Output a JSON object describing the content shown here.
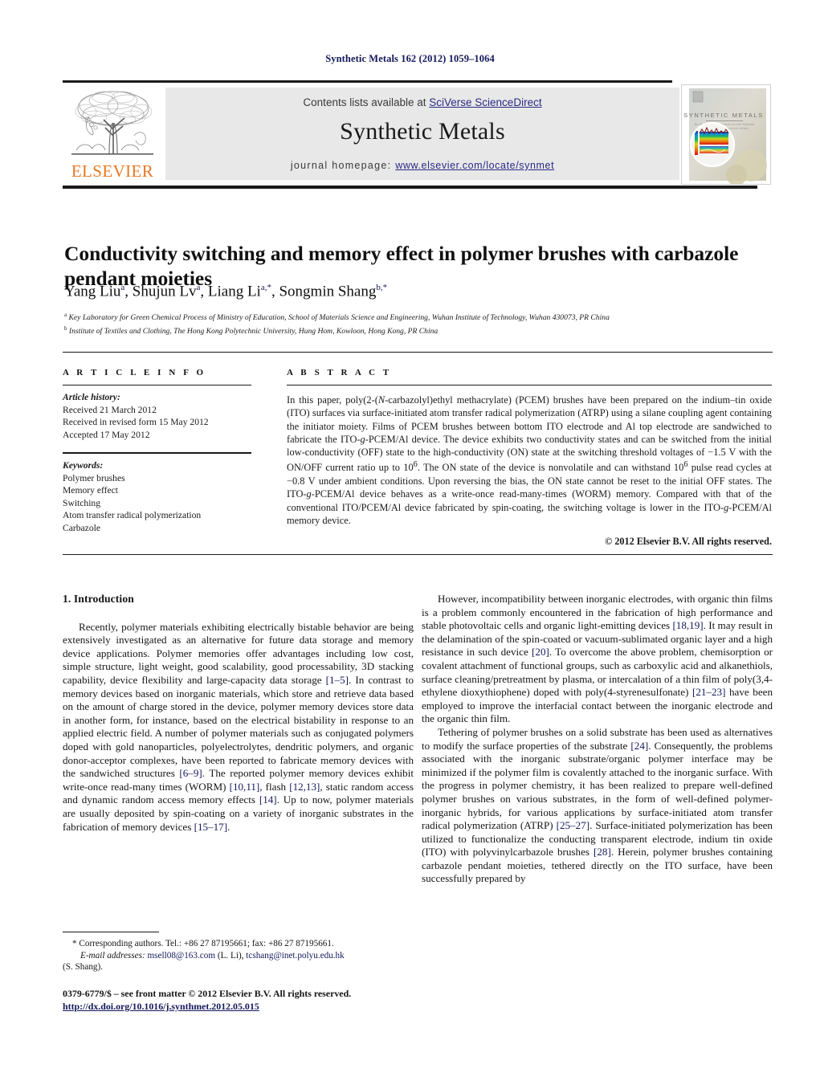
{
  "running_head": "Synthetic Metals 162 (2012) 1059–1064",
  "masthead": {
    "contents_prefix": "Contents lists available at ",
    "contents_link": "SciVerse ScienceDirect",
    "journal_title": "Synthetic Metals",
    "homepage_prefix": "journal homepage:",
    "homepage_url": "www.elsevier.com/locate/synmet",
    "publisher": "ELSEVIER",
    "cover_title": "SYNTHETIC METALS",
    "accent_orange": "#e87722",
    "link_color": "#2a2a86",
    "panel_color": "#e8e8e8"
  },
  "article": {
    "title": "Conductivity switching and memory effect in polymer brushes with carbazole pendant moieties",
    "authors_html": "Yang Liu<sup>a</sup>, Shujun Lv<sup>a</sup>, Liang Li<sup>a,*</sup>, Songmin Shang<sup>b,*</sup>",
    "affiliation_a": "Key Laboratory for Green Chemical Process of Ministry of Education, School of Materials Science and Engineering, Wuhan Institute of Technology, Wuhan 430073, PR China",
    "affiliation_b": "Institute of Textiles and Clothing, The Hong Kong Polytechnic University, Hung Hom, Kowloon, Hong Kong, PR China"
  },
  "article_info": {
    "heading": "A R T I C L E    I N F O",
    "history_label": "Article history:",
    "received": "Received 21 March 2012",
    "revised": "Received in revised form 15 May 2012",
    "accepted": "Accepted 17 May 2012",
    "keywords_label": "Keywords:",
    "keywords": [
      "Polymer brushes",
      "Memory effect",
      "Switching",
      "Atom transfer radical polymerization",
      "Carbazole"
    ]
  },
  "abstract": {
    "heading": "A B S T R A C T",
    "body_html": "In this paper, poly(2-(<i>N</i>-carbazolyl)ethyl methacrylate) (PCEM) brushes have been prepared on the indium–tin oxide (ITO) surfaces via surface-initiated atom transfer radical polymerization (ATRP) using a silane coupling agent containing the initiator moiety. Films of PCEM brushes between bottom ITO electrode and Al top electrode are sandwiched to fabricate the ITO-<i>g</i>-PCEM/Al device. The device exhibits two conductivity states and can be switched from the initial low-conductivity (OFF) state to the high-conductivity (ON) state at the switching threshold voltages of −1.5 V with the ON/OFF current ratio up to 10<sup>6</sup>. The ON state of the device is nonvolatile and can withstand 10<sup>6</sup> pulse read cycles at −0.8 V under ambient conditions. Upon reversing the bias, the ON state cannot be reset to the initial OFF states. The ITO-<i>g</i>-PCEM/Al device behaves as a write-once read-many-times (WORM) memory. Compared with that of the conventional ITO/PCEM/Al device fabricated by spin-coating, the switching voltage is lower in the ITO-<i>g</i>-PCEM/Al memory device.",
    "copyright": "© 2012 Elsevier B.V. All rights reserved."
  },
  "introduction": {
    "section_number_title": "1.  Introduction",
    "left_paragraph_1_html": "Recently, polymer materials exhibiting electrically bistable behavior are being extensively investigated as an alternative for future data storage and memory device applications. Polymer memories offer advantages including low cost, simple structure, light weight, good scalability, good processability, 3D stacking capability, device flexibility and large-capacity data storage <span class=\"ref\">[1–5]</span>. In contrast to memory devices based on inorganic materials, which store and retrieve data based on the amount of charge stored in the device, polymer memory devices store data in another form, for instance, based on the electrical bistability in response to an applied electric field. A number of polymer materials such as conjugated polymers doped with gold nanoparticles, polyelectrolytes, dendritic polymers, and organic donor-acceptor complexes, have been reported to fabricate memory devices with the sandwiched structures <span class=\"ref\">[6–9]</span>. The reported polymer memory devices exhibit write-once read-many times (WORM) <span class=\"ref\">[10,11]</span>, flash <span class=\"ref\">[12,13]</span>, static random access and dynamic random access memory effects <span class=\"ref\">[14]</span>. Up to now, polymer materials are usually deposited by spin-coating on a variety of inorganic substrates in the fabrication of memory devices <span class=\"ref\">[15–17]</span>.",
    "right_paragraph_1_html": "However, incompatibility between inorganic electrodes, with organic thin films is a problem commonly encountered in the fabrication of high performance and stable photovoltaic cells and organic light-emitting devices <span class=\"ref\">[18,19]</span>. It may result in the delamination of the spin-coated or vacuum-sublimated organic layer and a high resistance in such device <span class=\"ref\">[20]</span>. To overcome the above problem, chemisorption or covalent attachment of functional groups, such as carboxylic acid and alkanethiols, surface cleaning/pretreatment by plasma, or intercalation of a thin film of poly(3,4-ethylene dioxythiophene) doped with poly(4-styrenesulfonate) <span class=\"ref\">[21–23]</span> have been employed to improve the interfacial contact between the inorganic electrode and the organic thin film.",
    "right_paragraph_2_html": "Tethering of polymer brushes on a solid substrate has been used as alternatives to modify the surface properties of the substrate <span class=\"ref\">[24]</span>. Consequently, the problems associated with the inorganic substrate/organic polymer interface may be minimized if the polymer film is covalently attached to the inorganic surface. With the progress in polymer chemistry, it has been realized to prepare well-defined polymer brushes on various substrates, in the form of well-defined polymer-inorganic hybrids, for various applications by surface-initiated atom transfer radical polymerization (ATRP) <span class=\"ref\">[25–27]</span>. Surface-initiated polymerization has been utilized to functionalize the conducting transparent electrode, indium tin oxide (ITO) with polyvinylcarbazole brushes <span class=\"ref\">[28]</span>. Herein, polymer brushes containing carbazole pendant moieties, tethered directly on the ITO surface, have been successfully prepared by"
  },
  "footnote": {
    "corresponding_html": "* Corresponding authors. Tel.: +86 27 87195661; fax: +86 27 87195661.",
    "emails_html": "<span class=\"em-lead\">E-mail addresses:</span> <span class=\"mail\">msell08@163.com</span> (L. Li), <span class=\"mail\">tcshang@inet.polyu.edu.hk</span>",
    "emails_tail": "(S. Shang)."
  },
  "imprint": {
    "line1": "0379-6779/$ – see front matter © 2012 Elsevier B.V. All rights reserved.",
    "doi": "http://dx.doi.org/10.1016/j.synthmet.2012.05.015"
  }
}
